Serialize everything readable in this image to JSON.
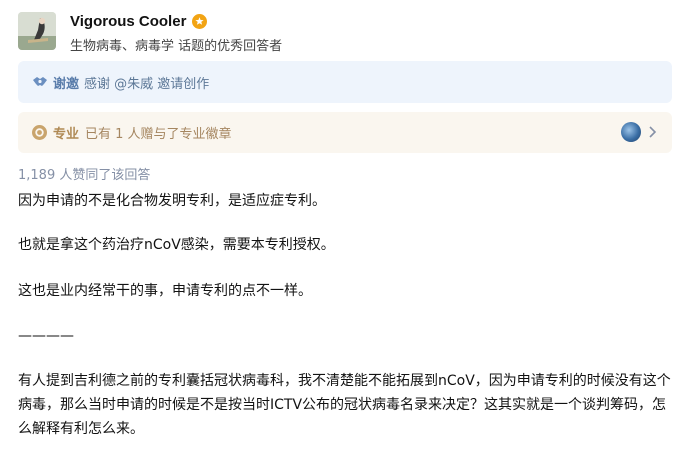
{
  "author": {
    "name": "Vigorous Cooler",
    "description": "生物病毒、病毒学 话题的优秀回答者"
  },
  "invite": {
    "tag": "谢邀",
    "text": "感谢 @朱威 邀请创作"
  },
  "pro": {
    "tag": "专业",
    "text": "已有 1 人赠与了专业徽章"
  },
  "votes": "1,189 人赞同了该回答",
  "answer": {
    "p1": "因为申请的不是化合物发明专利，是适应症专利。",
    "p2": "也就是拿这个药治疗nCoV感染，需要本专利授权。",
    "p3": "这也是业内经常干的事，申请专利的点不一样。",
    "divider": "————",
    "p5": "有人提到吉利德之前的专利囊括冠状病毒科，我不清楚能不能拓展到nCoV，因为申请专利的时候没有这个病毒，那么当时申请的时候是不是按当时ICTV公布的冠状病毒名录来决定？这其实就是一个谈判筹码，怎么解释有利怎么来。"
  }
}
